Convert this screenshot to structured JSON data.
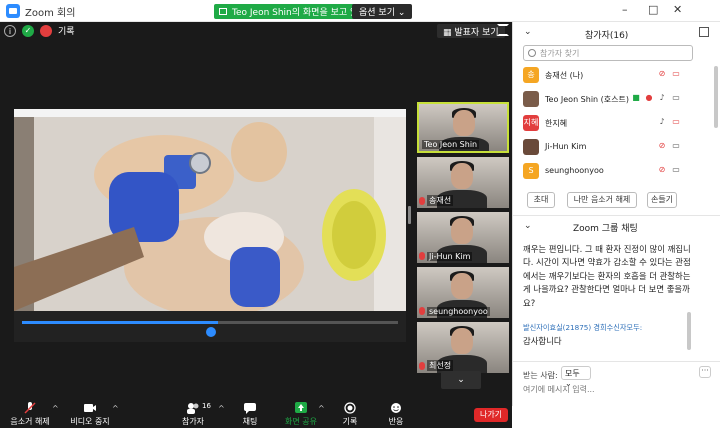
{
  "window": {
    "app_title": "Zoom 회의",
    "share_banner": "Teo Jeon Shin의 화면을 보고 있습니다.",
    "view_options": "옵션 보기 ⌄",
    "controls": [
      "–",
      "□",
      "✕"
    ]
  },
  "meeting": {
    "record_label": "기록",
    "speaker_view": "발표자 보기",
    "shared_progress": 0.52,
    "thumbnails": [
      {
        "name": "Teo Jeon Shin",
        "active": true,
        "muted": false
      },
      {
        "name": "송재선",
        "active": false,
        "muted": true
      },
      {
        "name": "Ji-Hun Kim",
        "active": false,
        "muted": true
      },
      {
        "name": "seunghoonyoo",
        "active": false,
        "muted": true
      },
      {
        "name": "최선정",
        "active": false,
        "muted": true
      }
    ],
    "more_thumbs": "⌄"
  },
  "toolbar": {
    "unmute": "음소거 해제",
    "stop_video": "비디오 중지",
    "participants": "참가자",
    "participants_count": "16",
    "chat": "채팅",
    "share_screen": "화면 공유",
    "record": "기록",
    "reactions": "반응",
    "leave": "나가기"
  },
  "panel": {
    "title": "참가자(16)",
    "search_placeholder": "참가자 찾기",
    "participants": [
      {
        "avatar": "송",
        "avatar_color": "#f5a623",
        "name": "송재선 (나)"
      },
      {
        "avatar": "",
        "avatar_color": "#7a5c4a",
        "name": "Teo Jeon Shin (호스트)"
      },
      {
        "avatar": "지혜",
        "avatar_color": "#e23e3e",
        "name": "한지혜"
      },
      {
        "avatar": "",
        "avatar_color": "#6a4a3a",
        "name": "Ji-Hun Kim"
      },
      {
        "avatar": "S",
        "avatar_color": "#f5a623",
        "name": "seunghoonyoo"
      }
    ],
    "buttons": {
      "invite": "초대",
      "unmute_me": "나만 음소거 해제",
      "raise_hand": "손들기"
    },
    "chat_title": "Zoom 그룹 채팅",
    "chat_text": "깨우는 편입니다. 그 때 환자 진정이 많이 깨집니다. 시간이 지나면 약효가 감소할 수 있다는 관점에서는 깨우기보다는 환자의 호흡을 더 관찰하는 게 나을까요? 관찰한다면 얼마나 더 보면 좋을까요?",
    "chat_meta": "발신자이효실(21875) 경희수신자모두:",
    "chat_msg2": "감사합니다",
    "to_label": "받는 사람:",
    "to_value": "모두 ⌄",
    "input_placeholder": "여기에 메시지 입력..."
  }
}
